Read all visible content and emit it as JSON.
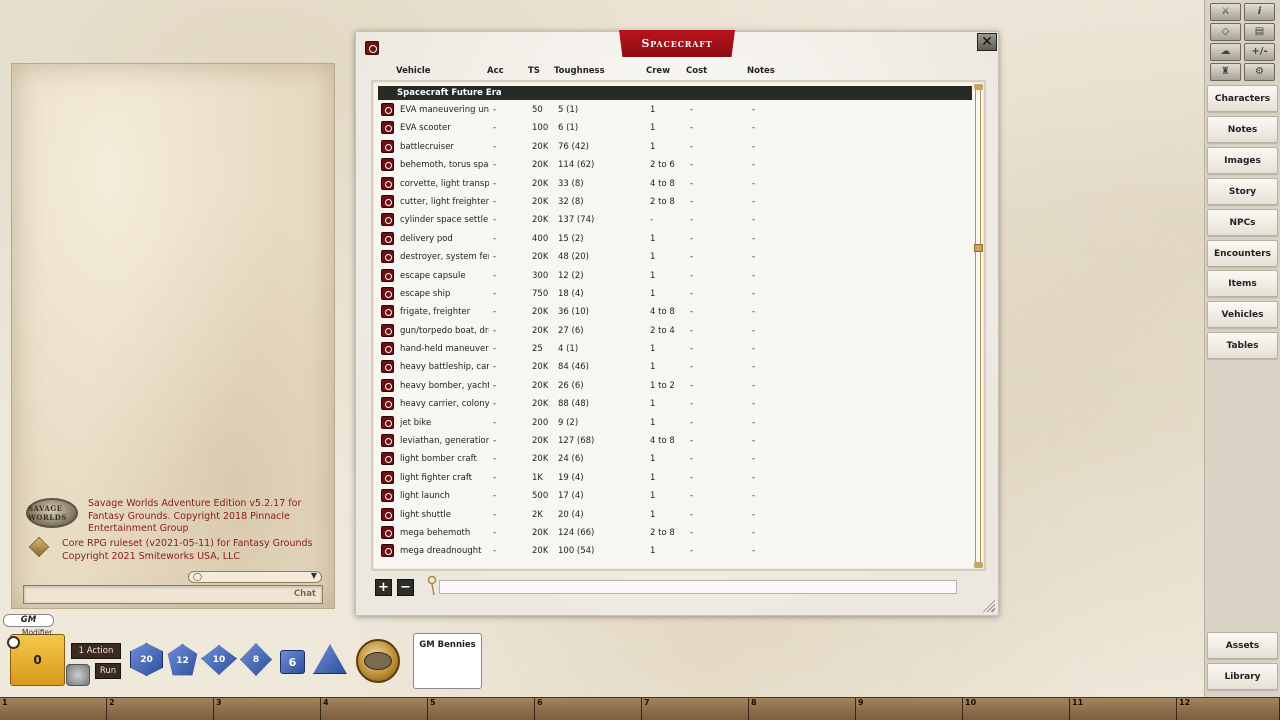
{
  "chat": {
    "messages": [
      {
        "logo": "savage-worlds-logo",
        "logo_text": "SAVAGE WORLDS",
        "text": "Savage Worlds Adventure Edition v5.2.17 for Fantasy Grounds. Copyright 2018 Pinnacle Entertainment Group"
      },
      {
        "logo": "fantasy-grounds-logo",
        "text": "Core RPG ruleset (v2021-05-11) for Fantasy Grounds Copyright 2021 Smiteworks USA, LLC"
      }
    ],
    "mode_icon": "speech-bubble-icon",
    "entry_label": "Chat"
  },
  "window": {
    "title": "Spacecraft",
    "columns": {
      "vehicle": "Vehicle",
      "acc": "Acc",
      "ts": "TS",
      "toughness": "Toughness",
      "crew": "Crew",
      "cost": "Cost",
      "notes": "Notes"
    },
    "group": "Spacecraft Future Era",
    "rows": [
      {
        "name": "EVA maneuvering unit",
        "acc": "-",
        "ts": "50",
        "toughness": "5 (1)",
        "crew": "1",
        "cost": "-",
        "notes": "-"
      },
      {
        "name": "EVA scooter",
        "acc": "-",
        "ts": "100",
        "toughness": "6 (1)",
        "crew": "1",
        "cost": "-",
        "notes": "-"
      },
      {
        "name": "battlecruiser",
        "acc": "-",
        "ts": "20K",
        "toughness": "76 (42)",
        "crew": "1",
        "cost": "-",
        "notes": "-"
      },
      {
        "name": "behemoth, torus space",
        "acc": "-",
        "ts": "20K",
        "toughness": "114 (62)",
        "crew": "2 to 6",
        "cost": "-",
        "notes": "-"
      },
      {
        "name": "corvette, light transport",
        "acc": "-",
        "ts": "20K",
        "toughness": "33 (8)",
        "crew": "4 to 8",
        "cost": "-",
        "notes": "-"
      },
      {
        "name": "cutter, light freighter",
        "acc": "-",
        "ts": "20K",
        "toughness": "32 (8)",
        "crew": "2 to 8",
        "cost": "-",
        "notes": "-"
      },
      {
        "name": "cylinder space settlement",
        "acc": "-",
        "ts": "20K",
        "toughness": "137 (74)",
        "crew": "-",
        "cost": "-",
        "notes": "-"
      },
      {
        "name": "delivery pod",
        "acc": "-",
        "ts": "400",
        "toughness": "15 (2)",
        "crew": "1",
        "cost": "-",
        "notes": "-"
      },
      {
        "name": "destroyer, system ferry",
        "acc": "-",
        "ts": "20K",
        "toughness": "48 (20)",
        "crew": "1",
        "cost": "-",
        "notes": "-"
      },
      {
        "name": "escape capsule",
        "acc": "-",
        "ts": "300",
        "toughness": "12 (2)",
        "crew": "1",
        "cost": "-",
        "notes": "-"
      },
      {
        "name": "escape ship",
        "acc": "-",
        "ts": "750",
        "toughness": "18 (4)",
        "crew": "1",
        "cost": "-",
        "notes": "-"
      },
      {
        "name": "frigate, freighter",
        "acc": "-",
        "ts": "20K",
        "toughness": "36 (10)",
        "crew": "4 to 8",
        "cost": "-",
        "notes": "-"
      },
      {
        "name": "gun/torpedo boat, drop ship",
        "acc": "-",
        "ts": "20K",
        "toughness": "27 (6)",
        "crew": "2 to 4",
        "cost": "-",
        "notes": "-"
      },
      {
        "name": "hand-held maneuvering unit",
        "acc": "-",
        "ts": "25",
        "toughness": "4 (1)",
        "crew": "1",
        "cost": "-",
        "notes": "-"
      },
      {
        "name": "heavy battleship, carrier",
        "acc": "-",
        "ts": "20K",
        "toughness": "84 (46)",
        "crew": "1",
        "cost": "-",
        "notes": "-"
      },
      {
        "name": "heavy bomber, yacht",
        "acc": "-",
        "ts": "20K",
        "toughness": "26 (6)",
        "crew": "1 to 2",
        "cost": "-",
        "notes": "-"
      },
      {
        "name": "heavy carrier, colony ship",
        "acc": "-",
        "ts": "20K",
        "toughness": "88 (48)",
        "crew": "1",
        "cost": "-",
        "notes": "-"
      },
      {
        "name": "jet bike",
        "acc": "-",
        "ts": "200",
        "toughness": "9 (2)",
        "crew": "1",
        "cost": "-",
        "notes": "-"
      },
      {
        "name": "leviathan, generation ship",
        "acc": "-",
        "ts": "20K",
        "toughness": "127 (68)",
        "crew": "4 to 8",
        "cost": "-",
        "notes": "-"
      },
      {
        "name": "light bomber craft",
        "acc": "-",
        "ts": "20K",
        "toughness": "24 (6)",
        "crew": "1",
        "cost": "-",
        "notes": "-"
      },
      {
        "name": "light fighter craft",
        "acc": "-",
        "ts": "1K",
        "toughness": "19 (4)",
        "crew": "1",
        "cost": "-",
        "notes": "-"
      },
      {
        "name": "light launch",
        "acc": "-",
        "ts": "500",
        "toughness": "17 (4)",
        "crew": "1",
        "cost": "-",
        "notes": "-"
      },
      {
        "name": "light shuttle",
        "acc": "-",
        "ts": "2K",
        "toughness": "20 (4)",
        "crew": "1",
        "cost": "-",
        "notes": "-"
      },
      {
        "name": "mega behemoth",
        "acc": "-",
        "ts": "20K",
        "toughness": "124 (66)",
        "crew": "2 to 8",
        "cost": "-",
        "notes": "-"
      },
      {
        "name": "mega dreadnought",
        "acc": "-",
        "ts": "20K",
        "toughness": "100 (54)",
        "crew": "1",
        "cost": "-",
        "notes": "-"
      }
    ],
    "add_label": "+",
    "delete_label": "−",
    "close_label": "✕"
  },
  "sidebar": {
    "tools": [
      {
        "icon": "crossed-swords-icon",
        "label": "⚔"
      },
      {
        "icon": "info-icon",
        "label": "i"
      },
      {
        "icon": "dice-icon",
        "label": "◇"
      },
      {
        "icon": "map-icon",
        "label": "▤"
      },
      {
        "icon": "brain-icon",
        "label": "☁"
      },
      {
        "icon": "plus-minus-icon",
        "label": "+/-"
      },
      {
        "icon": "figure-icon",
        "label": "♜"
      },
      {
        "icon": "settings-icon",
        "label": "⚙"
      }
    ],
    "buttons": [
      "Characters",
      "Notes",
      "Images",
      "Story",
      "NPCs",
      "Encounters",
      "Items",
      "Vehicles",
      "Tables"
    ],
    "bottom_buttons": [
      "Assets",
      "Library"
    ]
  },
  "bottom": {
    "gm_label": "GM",
    "modifier_label": "Modifier",
    "modifier_value": "0",
    "action_label": "1 Action",
    "run_label": "Run",
    "dice": [
      "20",
      "12",
      "10",
      "8",
      "6",
      ""
    ],
    "bennies_label": "GM Bennies",
    "hotkeys": [
      "1",
      "2",
      "3",
      "4",
      "5",
      "6",
      "7",
      "8",
      "9",
      "10",
      "11",
      "12"
    ]
  },
  "colors": {
    "title_tab": "#a8101a",
    "link_icon": "#6e1010",
    "group_header": "#2a2a24",
    "chat_text": "#8b1a1a",
    "die_blue": "#2d4f9c",
    "modifier_gold": "#e8b030"
  }
}
